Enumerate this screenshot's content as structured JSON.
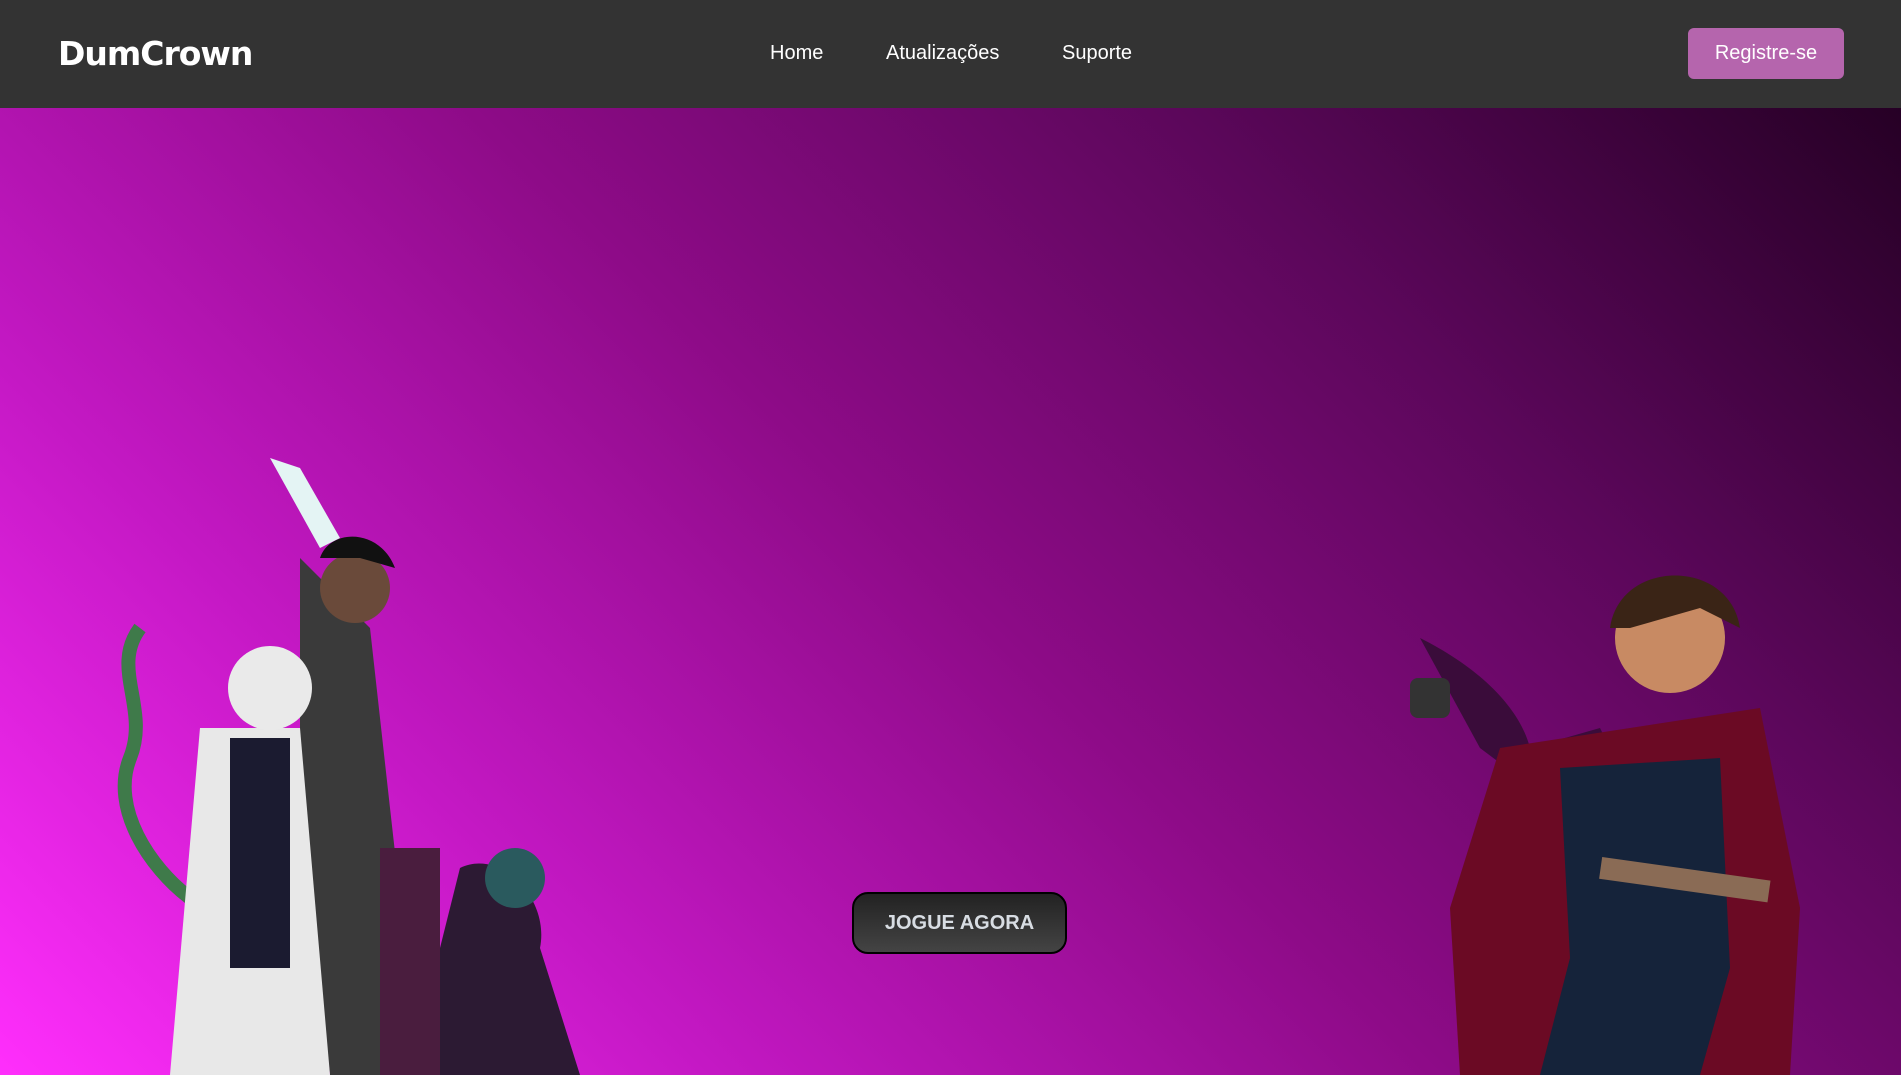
{
  "header": {
    "logo": "DumCrown",
    "nav": [
      "Home",
      "Atualizações",
      "Suporte"
    ],
    "register_label": "Registre-se"
  },
  "hero": {
    "play_label": "JOGUE AGORA"
  },
  "colors": {
    "nav_bg": "#333333",
    "register_bg": "#b565ad",
    "gradient_start": "#ff2efc",
    "gradient_end": "#260025"
  }
}
